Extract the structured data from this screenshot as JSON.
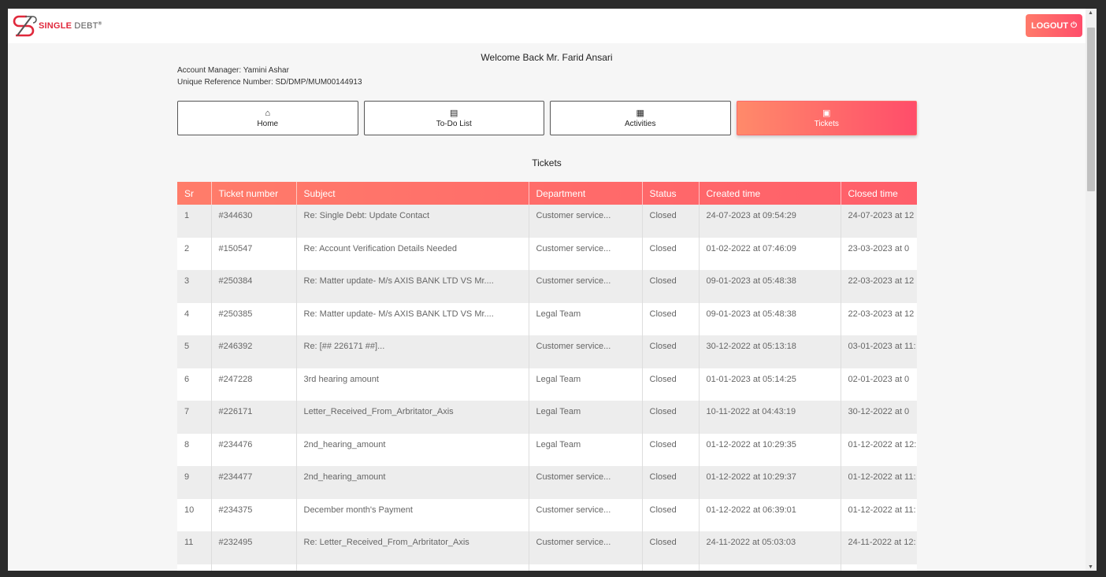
{
  "header": {
    "brand_single": "SINGLE",
    "brand_debt": "DEBT",
    "brand_mark": "®",
    "logout_label": "LOGOUT",
    "power_icon": "power-icon"
  },
  "welcome": "Welcome Back Mr. Farid Ansari",
  "account_manager": "Account Manager: Yamini Ashar",
  "reference": "Unique Reference Number: SD/DMP/MUM00144913",
  "nav": [
    {
      "label": "Home",
      "icon": "home-icon"
    },
    {
      "label": "To-Do List",
      "icon": "list-icon"
    },
    {
      "label": "Activities",
      "icon": "book-icon"
    },
    {
      "label": "Tickets",
      "icon": "ticket-icon"
    }
  ],
  "section_title": "Tickets",
  "table": {
    "columns": [
      "Sr",
      "Ticket number",
      "Subject",
      "Department",
      "Status",
      "Created time",
      "Closed time"
    ],
    "rows": [
      [
        "1",
        "#344630",
        "Re: Single Debt: Update Contact",
        "Customer service...",
        "Closed",
        "24-07-2023 at 09:54:29",
        "24-07-2023 at 12"
      ],
      [
        "2",
        "#150547",
        "Re: Account Verification Details Needed",
        "Customer service...",
        "Closed",
        "01-02-2022 at 07:46:09",
        "23-03-2023 at 0"
      ],
      [
        "3",
        "#250384",
        "Re: Matter update- M/s AXIS BANK LTD VS Mr....",
        "Customer service...",
        "Closed",
        "09-01-2023 at 05:48:38",
        "22-03-2023 at 12"
      ],
      [
        "4",
        "#250385",
        "Re: Matter update- M/s AXIS BANK LTD VS Mr....",
        "Legal Team",
        "Closed",
        "09-01-2023 at 05:48:38",
        "22-03-2023 at 12"
      ],
      [
        "5",
        "#246392",
        "Re: [## 226171 ##]...",
        "Customer service...",
        "Closed",
        "30-12-2022 at 05:13:18",
        "03-01-2023 at 11:"
      ],
      [
        "6",
        "#247228",
        "3rd hearing amount",
        "Legal Team",
        "Closed",
        "01-01-2023 at 05:14:25",
        "02-01-2023 at 0"
      ],
      [
        "7",
        "#226171",
        "Letter_Received_From_Arbritator_Axis",
        "Legal Team",
        "Closed",
        "10-11-2022 at 04:43:19",
        "30-12-2022 at 0"
      ],
      [
        "8",
        "#234476",
        "2nd_hearing_amount",
        "Legal Team",
        "Closed",
        "01-12-2022 at 10:29:35",
        "01-12-2022 at 12:"
      ],
      [
        "9",
        "#234477",
        "2nd_hearing_amount",
        "Customer service...",
        "Closed",
        "01-12-2022 at 10:29:37",
        "01-12-2022 at 11:"
      ],
      [
        "10",
        "#234375",
        "December month's Payment",
        "Customer service...",
        "Closed",
        "01-12-2022 at 06:39:01",
        "01-12-2022 at 11:"
      ],
      [
        "11",
        "#232495",
        "Re: Letter_Received_From_Arbritator_Axis",
        "Customer service...",
        "Closed",
        "24-11-2022 at 05:03:03",
        "24-11-2022 at 12:"
      ],
      [
        "",
        "",
        "",
        "",
        "",
        "",
        ""
      ]
    ]
  },
  "colors": {
    "accent_start": "#ff8a6a",
    "accent_end": "#ff4d6a",
    "brand_red": "#e0283b"
  }
}
